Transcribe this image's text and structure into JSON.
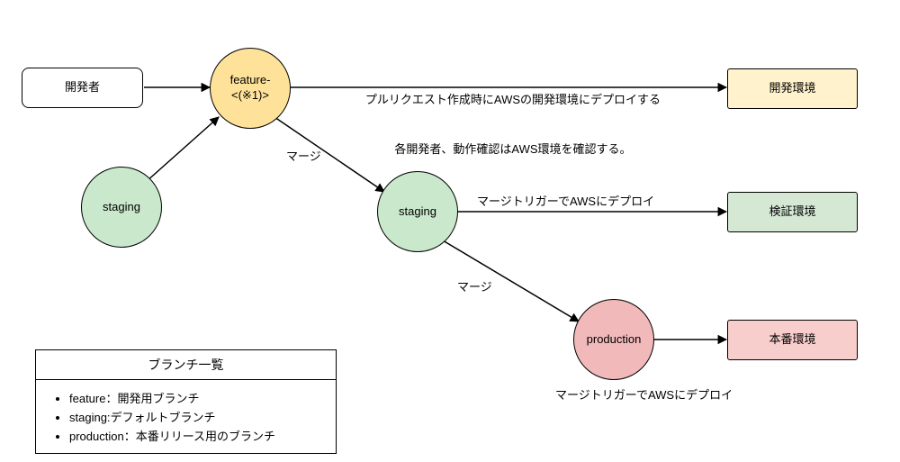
{
  "nodes": {
    "developer": "開発者",
    "feature_line1": "feature-",
    "feature_line2": "<(※1)>",
    "staging_left": "staging",
    "staging_mid": "staging",
    "production": "production",
    "env_dev": "開発環境",
    "env_stg": "検証環境",
    "env_prd": "本番環境"
  },
  "edges": {
    "pr_line1": "プルリクエスト作成時にAWSの開発環境にデプロイする",
    "pr_line2": "各開発者、動作確認はAWS環境を確認する。",
    "merge1": "マージ",
    "stg_deploy": "マージトリガーでAWSにデプロイ",
    "merge2": "マージ",
    "prd_deploy": "マージトリガーでAWSにデプロイ"
  },
  "legend": {
    "title": "ブランチ一覧",
    "items": [
      "feature：開発用ブランチ",
      "staging:デフォルトブランチ",
      "production：本番リリース用のブランチ"
    ]
  }
}
